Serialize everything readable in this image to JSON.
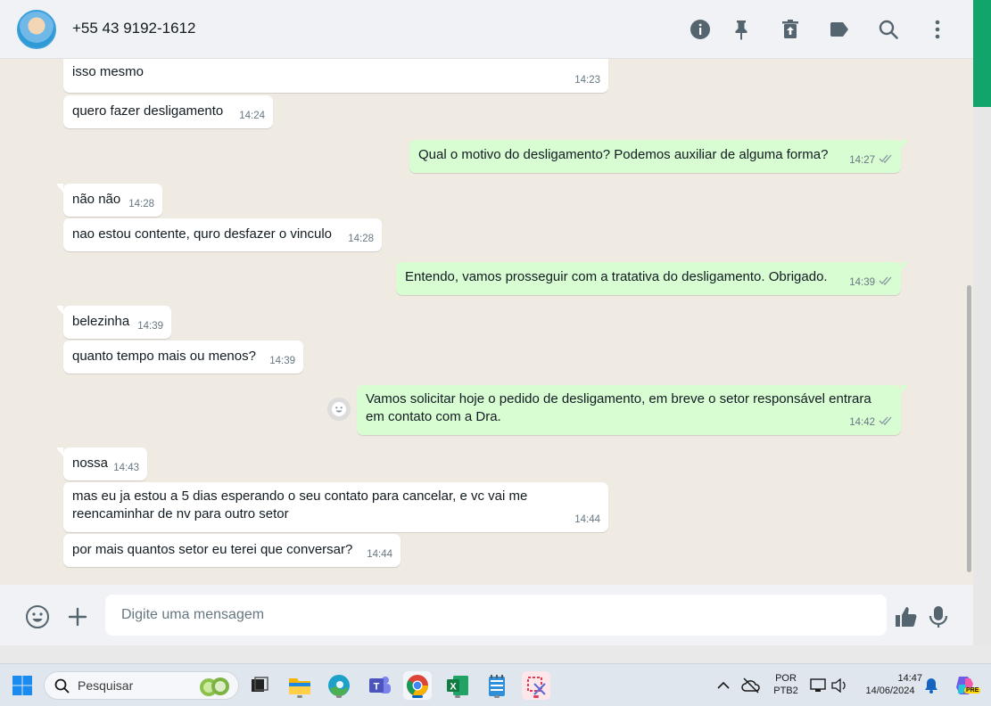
{
  "header": {
    "contact_name": "+55 43 9192-1612",
    "icons": [
      "info-icon",
      "pin-icon",
      "trash-icon",
      "label-icon",
      "search-icon",
      "menu-icon"
    ]
  },
  "messages": [
    {
      "dir": "in",
      "text": "isso mesmo",
      "time": "14:23"
    },
    {
      "dir": "in",
      "text": "quero fazer  desligamento",
      "time": "14:24"
    },
    {
      "dir": "out",
      "text": "Qual o motivo do desligamento? Podemos auxiliar de alguma forma?",
      "time": "14:27"
    },
    {
      "dir": "in",
      "text": "não não",
      "time": "14:28"
    },
    {
      "dir": "in",
      "text": "nao estou contente, quro desfazer o vinculo",
      "time": "14:28"
    },
    {
      "dir": "out",
      "text": "Entendo, vamos prosseguir com a tratativa do desligamento. Obrigado.",
      "time": "14:39"
    },
    {
      "dir": "in",
      "text": "belezinha",
      "time": "14:39"
    },
    {
      "dir": "in",
      "text": "quanto tempo mais ou menos?",
      "time": "14:39"
    },
    {
      "dir": "out",
      "text": "Vamos solicitar hoje o pedido de desligamento, em breve o setor responsável entrara em contato com a Dra.",
      "time": "14:42"
    },
    {
      "dir": "in",
      "text": "nossa",
      "time": "14:43"
    },
    {
      "dir": "in",
      "text": "mas eu ja estou a 5 dias esperando o seu contato para cancelar, e vc vai me reencaminhar de nv para outro setor",
      "time": "14:44"
    },
    {
      "dir": "in",
      "text": "por mais quantos setor eu terei que conversar?",
      "time": "14:44"
    }
  ],
  "composer": {
    "placeholder": "Digite uma mensagem"
  },
  "taskbar": {
    "search_label": "Pesquisar",
    "lang_top": "POR",
    "lang_bottom": "PTB2",
    "clock_time": "14:47",
    "clock_date": "14/06/2024",
    "pre_badge": "PRE"
  },
  "colors": {
    "bubble_out": "#d9fdd3",
    "bubble_in": "#ffffff",
    "chat_bg": "#efeae2",
    "accent_green": "#11a56c"
  }
}
